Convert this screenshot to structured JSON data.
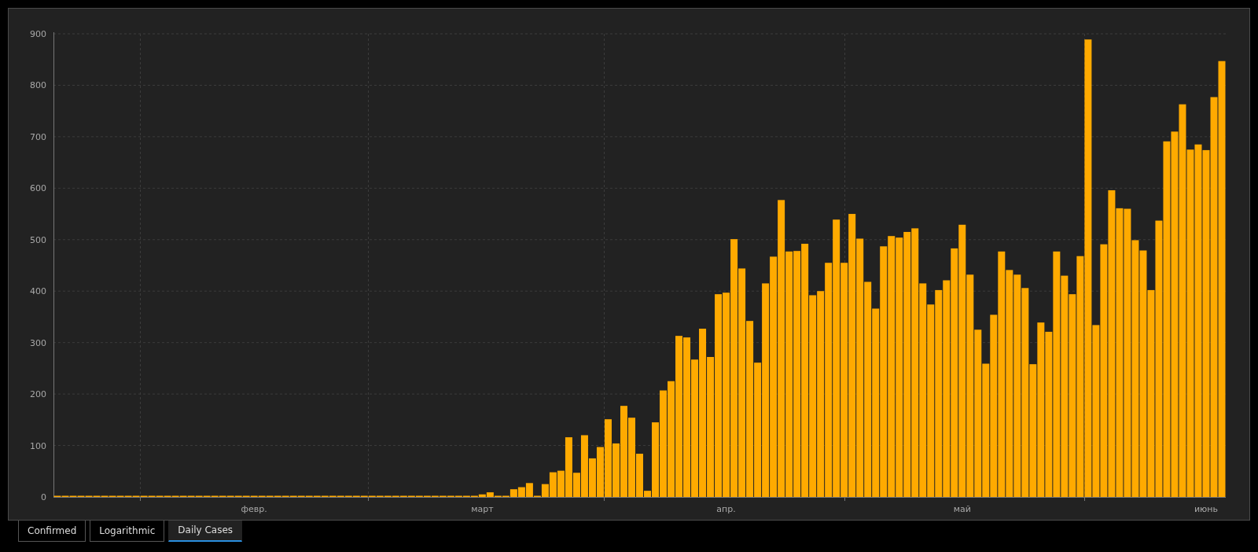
{
  "chart": {
    "chart_data": {
      "type": "bar",
      "categories": [
        null,
        null,
        null,
        null,
        null,
        null,
        null,
        null,
        null,
        null,
        null,
        null,
        null,
        null,
        null,
        null,
        null,
        null,
        null,
        null,
        null,
        null,
        null,
        null,
        null,
        "февр.",
        null,
        null,
        null,
        null,
        null,
        null,
        null,
        null,
        null,
        null,
        null,
        null,
        null,
        null,
        null,
        null,
        null,
        null,
        null,
        null,
        null,
        null,
        null,
        null,
        null,
        null,
        null,
        null,
        "март",
        null,
        null,
        null,
        null,
        null,
        null,
        null,
        null,
        null,
        null,
        null,
        null,
        null,
        null,
        null,
        null,
        null,
        null,
        null,
        null,
        null,
        null,
        null,
        null,
        null,
        null,
        null,
        null,
        null,
        null,
        "апр.",
        null,
        null,
        null,
        null,
        null,
        null,
        null,
        null,
        null,
        null,
        null,
        null,
        null,
        null,
        null,
        null,
        null,
        null,
        null,
        null,
        null,
        null,
        null,
        null,
        null,
        null,
        null,
        null,
        null,
        "май",
        null,
        null,
        null,
        null,
        null,
        null,
        null,
        null,
        null,
        null,
        null,
        null,
        null,
        null,
        null,
        null,
        null,
        null,
        null,
        null,
        null,
        null,
        null,
        null,
        null,
        null,
        null,
        null,
        null,
        null,
        "июнь",
        null,
        null
      ],
      "values": [
        0,
        0,
        0,
        0,
        0,
        0,
        0,
        0,
        0,
        0,
        0,
        0,
        0,
        0,
        0,
        0,
        0,
        0,
        0,
        0,
        0,
        0,
        0,
        0,
        0,
        0,
        0,
        0,
        0,
        0,
        0,
        0,
        0,
        0,
        0,
        0,
        0,
        0,
        0,
        0,
        0,
        2,
        0,
        0,
        0,
        0,
        0,
        0,
        0,
        0,
        0,
        2,
        0,
        0,
        5,
        9,
        0,
        2,
        15,
        19,
        27,
        1,
        25,
        48,
        51,
        116,
        47,
        120,
        75,
        97,
        151,
        104,
        177,
        154,
        84,
        12,
        145,
        207,
        225,
        313,
        310,
        267,
        327,
        272,
        394,
        397,
        501,
        444,
        342,
        261,
        415,
        467,
        577,
        477,
        478,
        492,
        392,
        400,
        455,
        539,
        455,
        550,
        502,
        418,
        366,
        487,
        507,
        504,
        515,
        522,
        415,
        374,
        402,
        421,
        483,
        529,
        432,
        325,
        259,
        354,
        477,
        441,
        432,
        406,
        258,
        339,
        321,
        477,
        430,
        394,
        468,
        889,
        334,
        491,
        596,
        561,
        560,
        499,
        479,
        402,
        537,
        691,
        710,
        763,
        675,
        685,
        674,
        777,
        847
      ],
      "grid": true,
      "ylim": [
        0,
        900
      ],
      "yticks": [
        0,
        100,
        200,
        300,
        400,
        500,
        600,
        700,
        800,
        900
      ]
    }
  },
  "tabs": [
    {
      "label": "Confirmed",
      "selected": false
    },
    {
      "label": "Logarithmic",
      "selected": false
    },
    {
      "label": "Daily Cases",
      "selected": true
    }
  ]
}
